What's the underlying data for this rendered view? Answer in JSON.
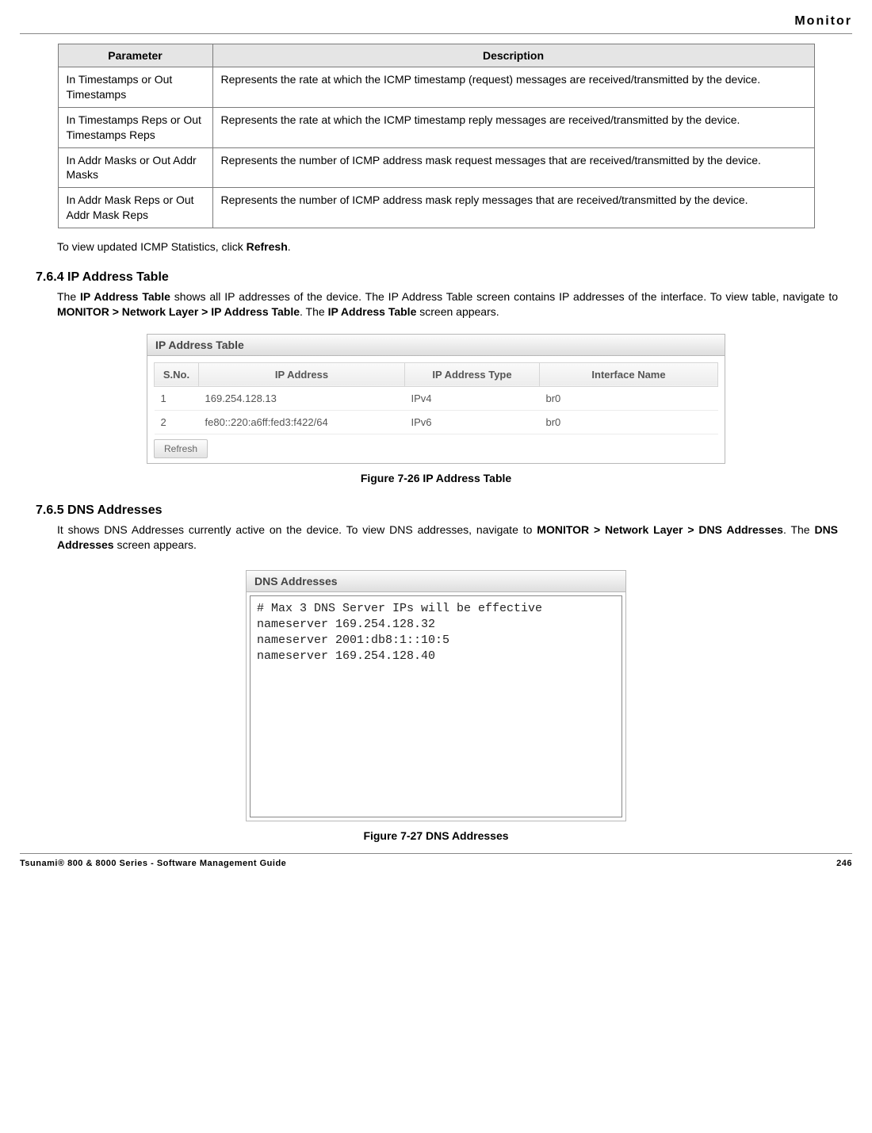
{
  "header": {
    "title": "Monitor"
  },
  "table": {
    "headers": {
      "param": "Parameter",
      "desc": "Description"
    },
    "rows": [
      {
        "param": "In Timestamps or Out Timestamps",
        "desc": "Represents the rate at which the ICMP timestamp (request) messages are received/transmitted by the device."
      },
      {
        "param": "In Timestamps Reps or Out Timestamps Reps",
        "desc": "Represents the rate at which the ICMP timestamp reply messages are received/transmitted by the device."
      },
      {
        "param": "In Addr Masks or Out Addr Masks",
        "desc": "Represents the number of ICMP address mask request messages that are received/transmitted by the device."
      },
      {
        "param": "In Addr Mask Reps or Out Addr Mask Reps",
        "desc": "Represents the number of ICMP address mask reply messages that are received/transmitted by the device."
      }
    ]
  },
  "texts": {
    "refresh_note_pre": "To view updated ICMP Statistics, click ",
    "refresh_note_bold": "Refresh",
    "refresh_note_post": ".",
    "sec764": "7.6.4 IP Address Table",
    "ip_desc_pre": "The ",
    "ip_desc_b1": "IP Address Table",
    "ip_desc_mid1": " shows all IP addresses of the device. The IP Address Table screen contains IP addresses of the interface. To view table, navigate to ",
    "ip_desc_b2": "MONITOR > Network Layer > IP Address Table",
    "ip_desc_mid2": ". The ",
    "ip_desc_b3": "IP Address Table",
    "ip_desc_post": " screen appears.",
    "fig726": "Figure 7-26 IP Address Table",
    "sec765": "7.6.5 DNS Addresses",
    "dns_desc_pre": "It shows DNS Addresses currently active on the device. To view DNS addresses, navigate to ",
    "dns_desc_b1": "MONITOR > Network Layer > DNS Addresses",
    "dns_desc_mid": ". The ",
    "dns_desc_b2": "DNS Addresses",
    "dns_desc_post": " screen appears.",
    "fig727": "Figure 7-27 DNS Addresses"
  },
  "ip_panel": {
    "title": "IP Address Table",
    "headers": {
      "sno": "S.No.",
      "addr": "IP Address",
      "type": "IP Address Type",
      "iface": "Interface Name"
    },
    "rows": [
      {
        "sno": "1",
        "addr": "169.254.128.13",
        "type": "IPv4",
        "iface": "br0"
      },
      {
        "sno": "2",
        "addr": "fe80::220:a6ff:fed3:f422/64",
        "type": "IPv6",
        "iface": "br0"
      }
    ],
    "refresh": "Refresh"
  },
  "dns_panel": {
    "title": "DNS Addresses",
    "content": "# Max 3 DNS Server IPs will be effective\nnameserver 169.254.128.32\nnameserver 2001:db8:1::10:5\nnameserver 169.254.128.40"
  },
  "footer": {
    "left": "Tsunami® 800 & 8000 Series - Software Management Guide",
    "right": "246"
  }
}
